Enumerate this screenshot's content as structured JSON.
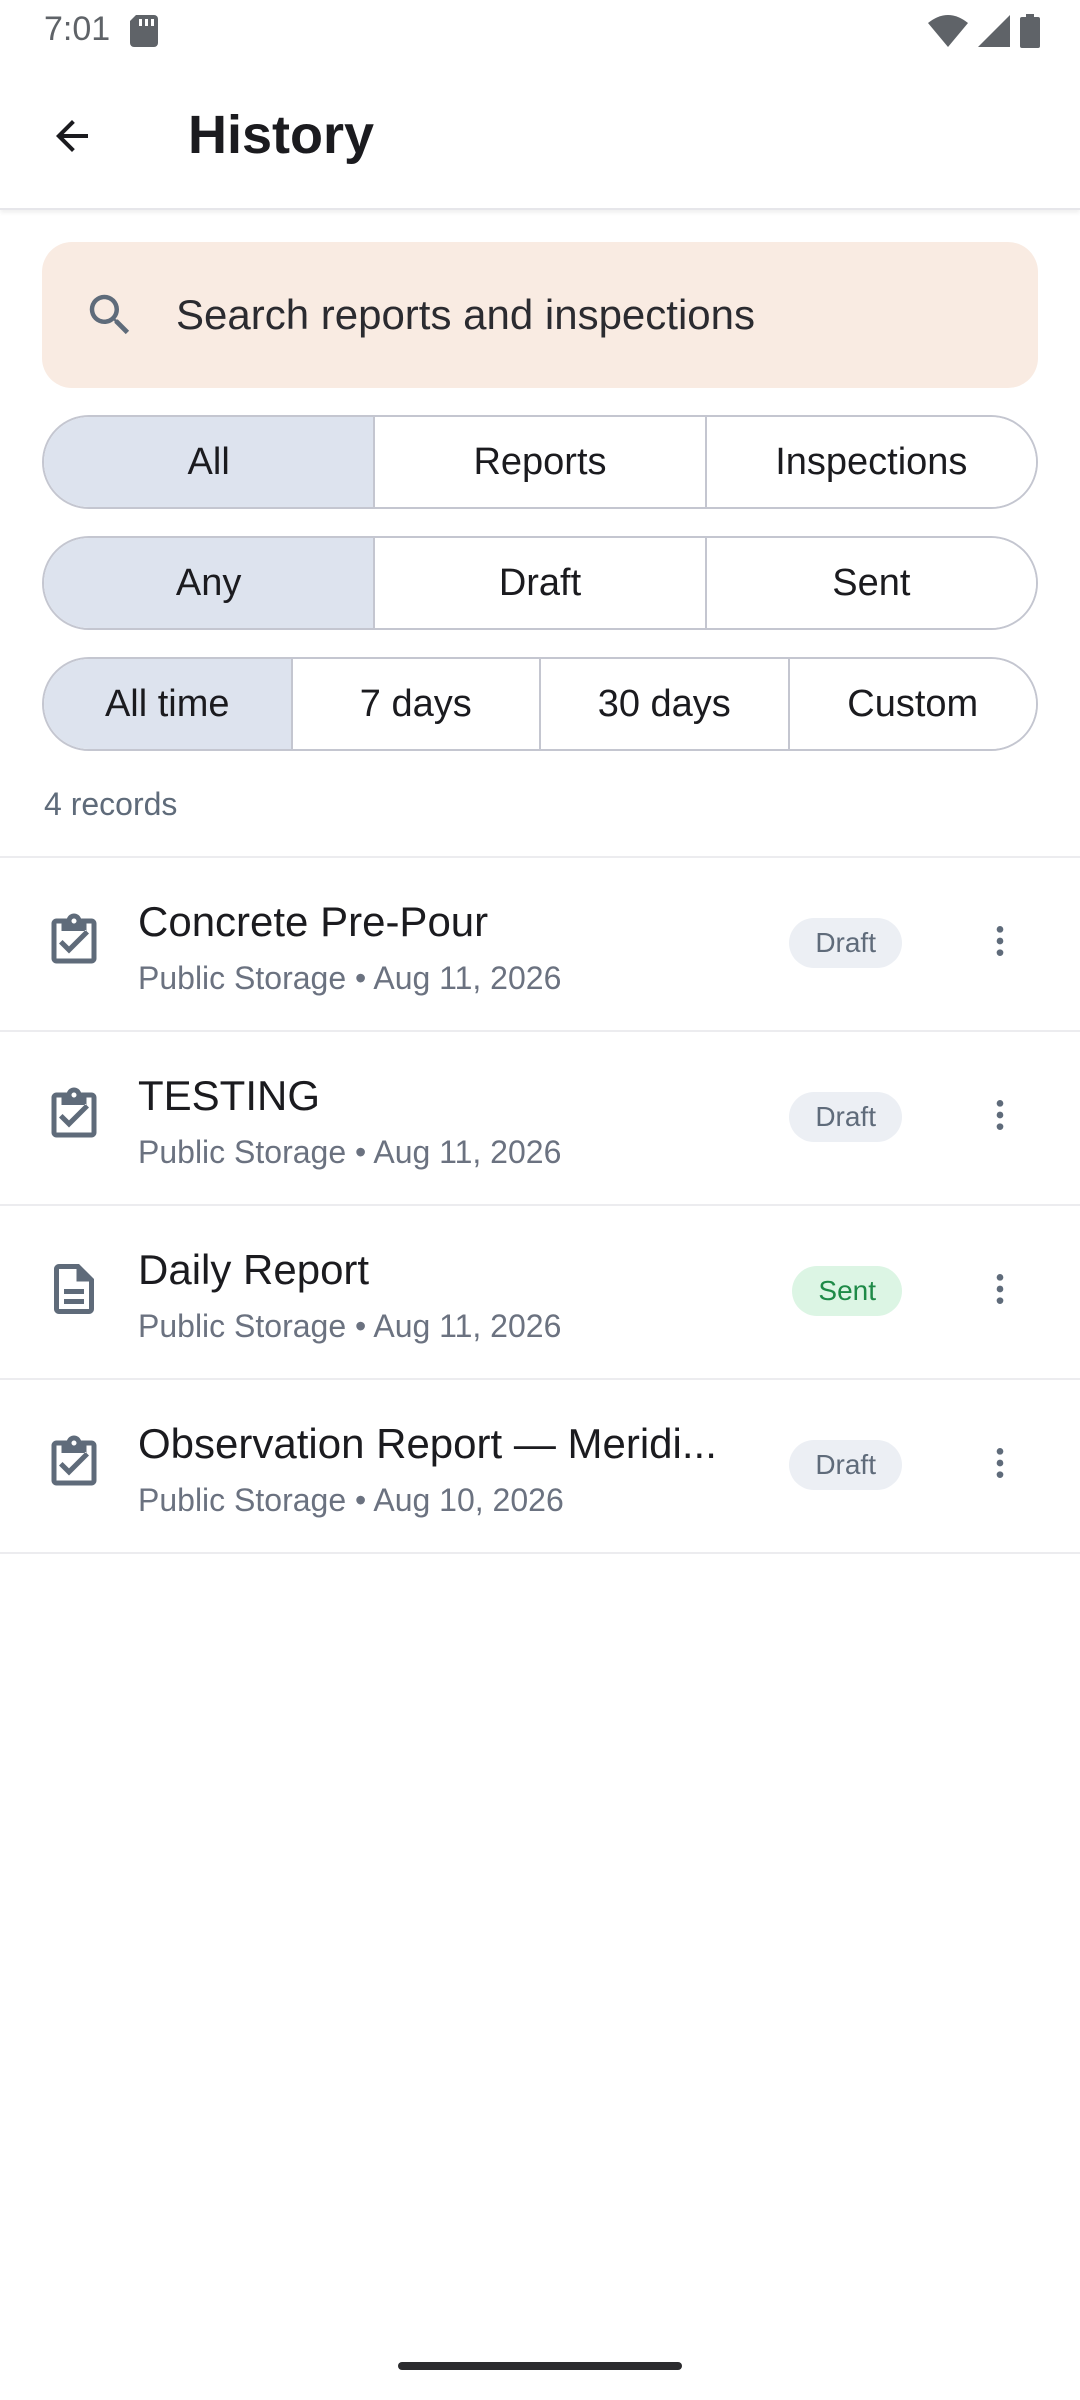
{
  "status_bar": {
    "time": "7:01"
  },
  "app_bar": {
    "title": "History"
  },
  "search": {
    "placeholder": "Search reports and inspections"
  },
  "filters": {
    "type": {
      "options": [
        "All",
        "Reports",
        "Inspections"
      ],
      "selected": "All"
    },
    "status": {
      "options": [
        "Any",
        "Draft",
        "Sent"
      ],
      "selected": "Any"
    },
    "time_range": {
      "options": [
        "All time",
        "7 days",
        "30 days",
        "Custom"
      ],
      "selected": "All time"
    }
  },
  "records_count": "4 records",
  "records": [
    {
      "icon": "clipboard-check-icon",
      "title": "Concrete Pre-Pour",
      "subtitle": "Public Storage • Aug 11, 2026",
      "status": "Draft"
    },
    {
      "icon": "clipboard-check-icon",
      "title": "TESTING",
      "subtitle": "Public Storage • Aug 11, 2026",
      "status": "Draft"
    },
    {
      "icon": "document-icon",
      "title": "Daily Report",
      "subtitle": "Public Storage • Aug 11, 2026",
      "status": "Sent"
    },
    {
      "icon": "clipboard-check-icon",
      "title": "Observation Report — Meridi...",
      "subtitle": "Public Storage • Aug 10, 2026",
      "status": "Draft"
    }
  ],
  "colors": {
    "search_bg": "#f9ebe2",
    "segment_selected": "#dde3ee",
    "draft_badge_bg": "#eceff4",
    "sent_badge_bg": "#dcf5e4",
    "sent_badge_text": "#1e8a47",
    "icon_color": "#5f6b7a"
  }
}
